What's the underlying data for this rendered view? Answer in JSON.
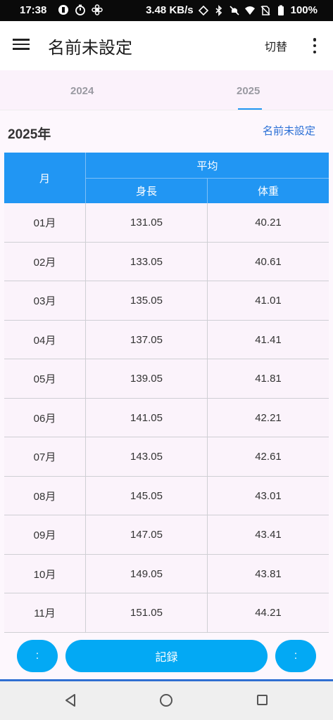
{
  "status_bar": {
    "time": "17:38",
    "network_speed": "3.48 KB/s",
    "battery": "100%"
  },
  "app_bar": {
    "title": "名前未設定",
    "switch_label": "切替"
  },
  "tabs": [
    {
      "label": "2024",
      "selected": false
    },
    {
      "label": "2025",
      "selected": true
    }
  ],
  "section": {
    "year_title": "2025年",
    "name_link": "名前未設定"
  },
  "table": {
    "header_month": "月",
    "header_average": "平均",
    "header_height": "身長",
    "header_weight": "体重",
    "rows": [
      {
        "month": "01月",
        "height": "131.05",
        "weight": "40.21"
      },
      {
        "month": "02月",
        "height": "133.05",
        "weight": "40.61"
      },
      {
        "month": "03月",
        "height": "135.05",
        "weight": "41.01"
      },
      {
        "month": "04月",
        "height": "137.05",
        "weight": "41.41"
      },
      {
        "month": "05月",
        "height": "139.05",
        "weight": "41.81"
      },
      {
        "month": "06月",
        "height": "141.05",
        "weight": "42.21"
      },
      {
        "month": "07月",
        "height": "143.05",
        "weight": "42.61"
      },
      {
        "month": "08月",
        "height": "145.05",
        "weight": "43.01"
      },
      {
        "month": "09月",
        "height": "147.05",
        "weight": "43.41"
      },
      {
        "month": "10月",
        "height": "149.05",
        "weight": "43.81"
      },
      {
        "month": "11月",
        "height": "151.05",
        "weight": "44.21"
      }
    ]
  },
  "bottom": {
    "left_label": ":",
    "record_label": "記録",
    "right_label": ":"
  },
  "colors": {
    "accent": "#2196f3",
    "button": "#03a9f4",
    "link": "#2a6fd6"
  }
}
